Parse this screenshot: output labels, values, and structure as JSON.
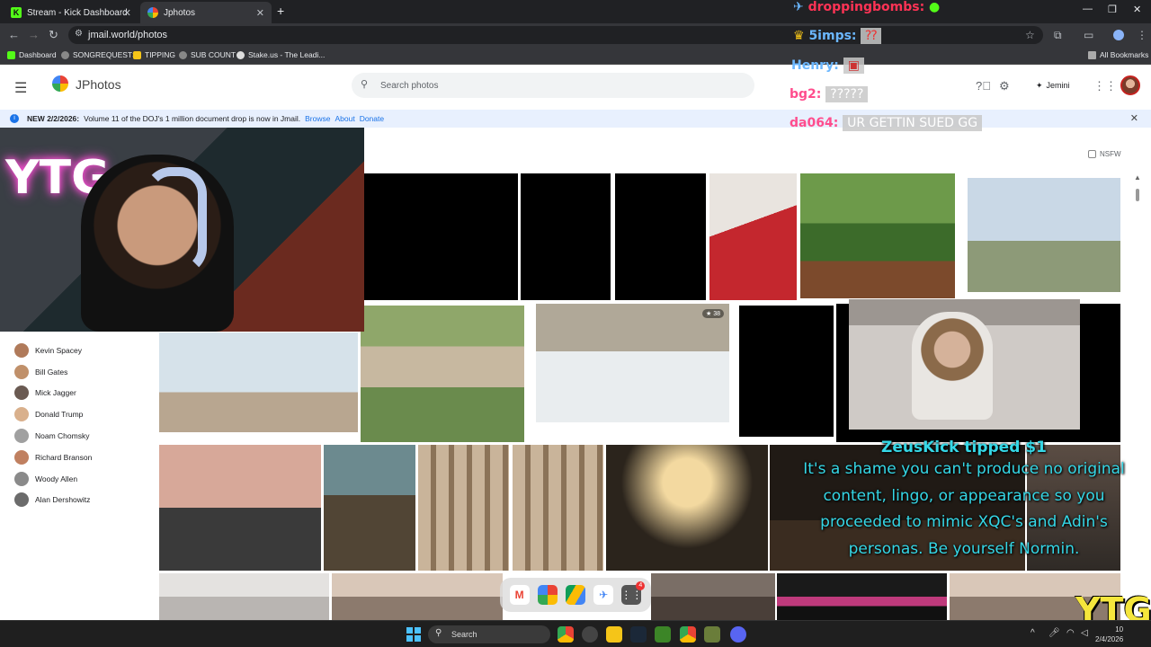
{
  "browser": {
    "tabs": [
      {
        "label": "Stream - Kick Dashboard"
      },
      {
        "label": "Jphotos"
      }
    ],
    "url": "jmail.world/photos",
    "bookmarks": [
      "Dashboard",
      "SONGREQUESTS",
      "TIPPING",
      "SUB COUNT",
      "Stake.us - The Leadi..."
    ],
    "all_bookmarks": "All Bookmarks"
  },
  "app": {
    "name": "JPhotos",
    "search_placeholder": "Search photos",
    "gemini_label": "Jemini"
  },
  "banner": {
    "lead": "NEW 2/2/2026:",
    "text": "Volume 11 of the DOJ's 1 million document drop is now in Jmail.",
    "links": [
      "Browse",
      "About",
      "Donate"
    ]
  },
  "filter": {
    "nsfw_label": "NSFW"
  },
  "people": [
    {
      "name": "Kevin Spacey",
      "color": "#b07a5a"
    },
    {
      "name": "Bill Gates",
      "color": "#c0906a"
    },
    {
      "name": "Mick Jagger",
      "color": "#6a5a52"
    },
    {
      "name": "Donald Trump",
      "color": "#d9b08c"
    },
    {
      "name": "Noam Chomsky",
      "color": "#a0a0a0"
    },
    {
      "name": "Richard Branson",
      "color": "#c08060"
    },
    {
      "name": "Woody Allen",
      "color": "#8a8a8a"
    },
    {
      "name": "Alan Dershowitz",
      "color": "#6b6b6b"
    }
  ],
  "photo_badge": "38",
  "chat": [
    {
      "user": "droppingbombs:",
      "message": "",
      "color": "#ff3355"
    },
    {
      "user": "5imps:",
      "message": "",
      "color": "#6bb7ff"
    },
    {
      "user": "Henry:",
      "message": "",
      "color": "#6bb7ff"
    },
    {
      "user": "bg2:",
      "message": "?????",
      "color": "#ff4d8d"
    },
    {
      "user": "da064:",
      "message": "UR GETTIN SUED GG",
      "color": "#ff4d8d"
    }
  ],
  "tip": {
    "title": "ZeusKick tipped $1",
    "lines": [
      "It's a shame you can't produce no original",
      "content, lingo, or appearance so you",
      "proceeded to mimic XQC's and Adin's",
      "personas. Be yourself Normin."
    ]
  },
  "overlay_text": {
    "neon": "YTG",
    "watermark": "YTG"
  },
  "taskbar": {
    "search_label": "Search",
    "time": "10",
    "date": "2/4/2026"
  },
  "dock": {
    "badge": "4"
  },
  "colors": {
    "accent": "#1a73e8",
    "kick_green": "#53fc18",
    "tip_cyan": "#35d7e6"
  }
}
